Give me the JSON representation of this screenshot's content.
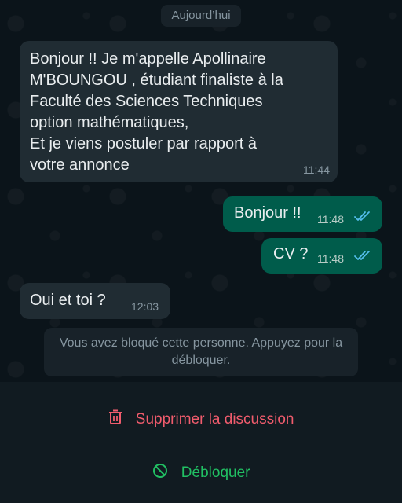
{
  "date_separator": "Aujourd’hui",
  "messages": [
    {
      "direction": "incoming",
      "text": "Bonjour !! Je m'appelle Apollinaire\nM'BOUNGOU , étudiant finaliste à la\nFaculté des Sciences Techniques\noption mathématiques,\nEt je viens postuler par rapport à\nvotre annonce",
      "time": "11:44"
    },
    {
      "direction": "outgoing",
      "text": "Bonjour !!",
      "time": "11:48",
      "status": "read"
    },
    {
      "direction": "outgoing",
      "text": "CV ?",
      "time": "11:48",
      "status": "read"
    },
    {
      "direction": "incoming",
      "text": "Oui et toi ?",
      "time": "12:03"
    }
  ],
  "system_notice": "Vous avez bloqué cette personne. Appuyez pour la débloquer.",
  "actions": {
    "delete_label": "Supprimer la discussion",
    "delete_icon": "trash-icon",
    "unblock_label": "Débloquer",
    "unblock_icon": "block-icon"
  },
  "colors": {
    "background": "#0b141a",
    "incoming_bubble": "#202c33",
    "outgoing_bubble": "#005c4b",
    "read_ticks": "#53bdeb",
    "delete": "#f15c6d",
    "unblock": "#21c063"
  }
}
